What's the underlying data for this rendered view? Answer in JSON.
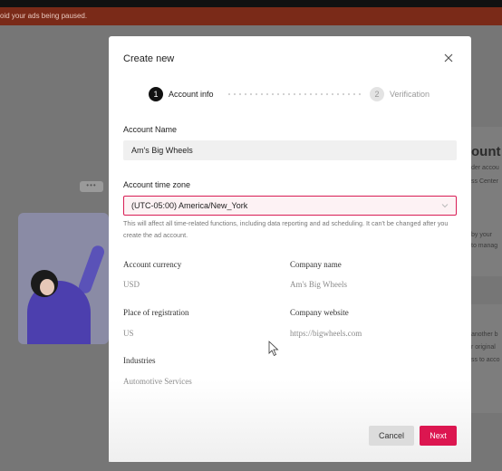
{
  "banner": {
    "warning_text": "oid your ads being paused."
  },
  "background": {
    "heading": "ount",
    "lines_top": [
      "der accou",
      "ss Center",
      "by your",
      "to manag"
    ],
    "lines_bottom": [
      "another b",
      "r original",
      "ss to acco"
    ],
    "bubble_dots": "•••"
  },
  "modal": {
    "title": "Create new",
    "steps": [
      {
        "number": "1",
        "label": "Account info",
        "active": true
      },
      {
        "number": "2",
        "label": "Verification",
        "active": false
      }
    ],
    "account_name": {
      "label": "Account Name",
      "value": "Am's Big Wheels"
    },
    "time_zone": {
      "label": "Account time zone",
      "value": "(UTC-05:00) America/New_York",
      "helper": "This will affect all time-related functions, including data reporting and ad scheduling. It can't be changed after you create the ad account."
    },
    "info": {
      "currency_label": "Account currency",
      "currency_value": "USD",
      "company_label": "Company name",
      "company_value": "Am's Big Wheels",
      "registration_label": "Place of registration",
      "registration_value": "US",
      "website_label": "Company website",
      "website_value": "https://bigwheels.com",
      "industries_label": "Industries",
      "industries_value": "Automotive Services"
    },
    "buttons": {
      "cancel": "Cancel",
      "next": "Next"
    }
  },
  "colors": {
    "accent": "#dc1650",
    "overlay": "#767676",
    "warning": "#7a2a18"
  }
}
